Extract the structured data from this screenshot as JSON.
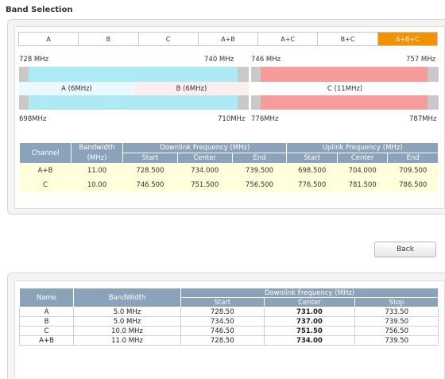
{
  "page_title": "Band Selection",
  "tabs": [
    {
      "label": "A",
      "active": false
    },
    {
      "label": "B",
      "active": false
    },
    {
      "label": "C",
      "active": false
    },
    {
      "label": "A+B",
      "active": false
    },
    {
      "label": "A+C",
      "active": false
    },
    {
      "label": "B+C",
      "active": false
    },
    {
      "label": "A+B+C",
      "active": true
    }
  ],
  "spectrum": {
    "downlink_left_start": "728 MHz",
    "downlink_left_end": "740 MHz",
    "downlink_right_start": "746 MHz",
    "downlink_right_end": "757 MHz",
    "uplink_left_start": "698MHz",
    "uplink_left_end": "710MHz",
    "uplink_right_start": "776MHz",
    "uplink_right_end": "787MHz",
    "band_a_label": "A (6MHz)",
    "band_b_label": "B (6MHz)",
    "band_c_label": "C (11MHz)"
  },
  "channel_table": {
    "headers": {
      "channel": "Channel",
      "bandwidth": "Bandwidth",
      "bandwidth_unit": "(MHz)",
      "downlink": "Downlink Frequency (MHz)",
      "uplink": "Uplink Frequency (MHz)",
      "start": "Start",
      "center": "Center",
      "end": "End"
    },
    "rows": [
      [
        "A+B",
        "11.00",
        "728.500",
        "734.000",
        "739.500",
        "698.500",
        "704.000",
        "709.500"
      ],
      [
        "C",
        "10.00",
        "746.500",
        "751.500",
        "756.500",
        "776.500",
        "781.500",
        "786.500"
      ]
    ]
  },
  "back_label": "Back",
  "summary_table": {
    "headers": {
      "name": "Name",
      "bandwidth": "BandWidth",
      "downlink": "Downlink Frequency (MHz)",
      "start": "Start",
      "center": "Center",
      "stop": "Stop"
    },
    "rows": [
      [
        "A",
        "5.0 MHz",
        "728.50",
        "731.00",
        "733.50"
      ],
      [
        "B",
        "5.0 MHz",
        "734.50",
        "737.00",
        "739.50"
      ],
      [
        "C",
        "10.0 MHz",
        "746.50",
        "751.50",
        "756.50"
      ],
      [
        "A+B",
        "11.0 MHz",
        "728.50",
        "734.00",
        "739.50"
      ]
    ]
  },
  "colors": {
    "band_ab": "#aeeaf6",
    "band_ab_light": "#eaf9fd",
    "band_b_inner": "#fbeeee",
    "band_c": "#f79c9c",
    "band_c_inner": "#ffffff",
    "gray_edge": "#c9c9c9",
    "active_tab": "#f39200",
    "header_bg": "#8aa3ba"
  }
}
